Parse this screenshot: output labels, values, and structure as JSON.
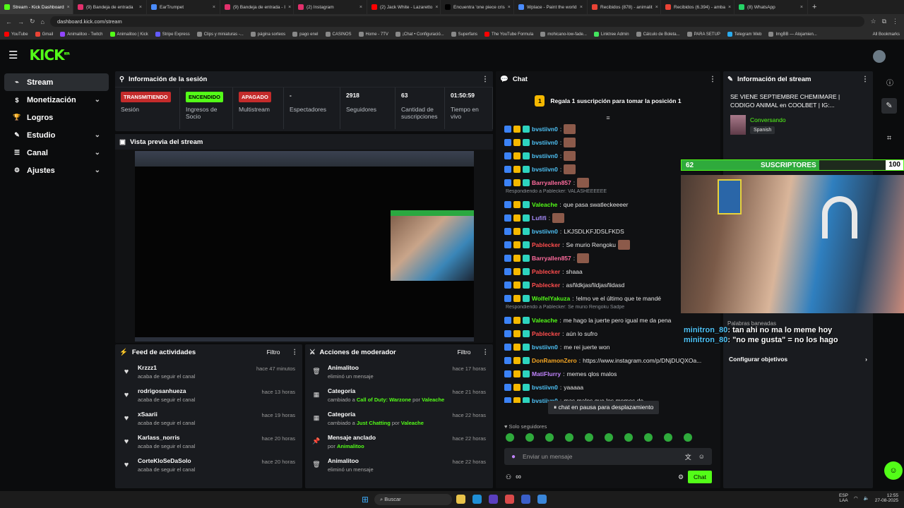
{
  "browser": {
    "tabs": [
      {
        "label": "Stream - Kick Dashboard",
        "color": "#53fc18",
        "active": true
      },
      {
        "label": "(9) Bandeja de entrada",
        "color": "#e1306c"
      },
      {
        "label": "EarTrumpet",
        "color": "#4a8cff"
      },
      {
        "label": "(9) Bandeja de entrada - I",
        "color": "#e1306c"
      },
      {
        "label": "(2) Instagram",
        "color": "#e1306c"
      },
      {
        "label": "(2) Jack White - Lazaretto",
        "color": "#ff0000"
      },
      {
        "label": "Encuentra 'one piece cris",
        "color": "#000000"
      },
      {
        "label": "Wplace - Paint the world",
        "color": "#4a8cff"
      },
      {
        "label": "Recibidos (878) - animalit",
        "color": "#ea4335"
      },
      {
        "label": "Recibidos (6.394) - amba",
        "color": "#ea4335"
      },
      {
        "label": "(8) WhatsApp",
        "color": "#25d366"
      }
    ],
    "url": "dashboard.kick.com/stream",
    "bookmarks": [
      "YouTube",
      "Gmail",
      "Animalitoo - Twitch",
      "Animalitoo | Kick",
      "Stripe Express",
      "Clips y miniaturas -...",
      "página sorteos",
      "pago enel",
      "CASINOS",
      "Home - 7TV",
      "¡Chat • Configuració...",
      "Superfans",
      "The YouTube Formula",
      "mohicano-low-fade...",
      "Linktree Admin",
      "Cálculo de Boleta...",
      "PARA SETUP",
      "Telegram Web",
      "ImgBB — Alojamien..."
    ],
    "all_bookmarks": "All Bookmarks"
  },
  "kick": {
    "logo": "KICK",
    "logo_sup": "BETA"
  },
  "sidebar": {
    "items": [
      {
        "label": "Stream",
        "icon": "stream-icon",
        "active": true
      },
      {
        "label": "Monetización",
        "icon": "dollar-icon",
        "chevron": true
      },
      {
        "label": "Logros",
        "icon": "trophy-icon"
      },
      {
        "label": "Estudio",
        "icon": "studio-icon",
        "chevron": true
      },
      {
        "label": "Canal",
        "icon": "channel-icon",
        "chevron": true
      },
      {
        "label": "Ajustes",
        "icon": "gear-icon",
        "chevron": true
      }
    ]
  },
  "session": {
    "title": "Información de la sesión",
    "stats": [
      {
        "badge": "TRANSMITIENDO",
        "badge_color": "#c42b2b",
        "label": "Sesión"
      },
      {
        "badge": "ENCENDIDO",
        "badge_color": "#53fc18",
        "label": "Ingresos de Socio"
      },
      {
        "badge": "APAGADO",
        "badge_color": "#c42b2b",
        "label": "Multistream"
      },
      {
        "value": "-",
        "label": "Espectadores"
      },
      {
        "value": "2918",
        "label": "Seguidores"
      },
      {
        "value": "63",
        "label": "Cantidad de suscripciones"
      },
      {
        "value": "01:50:59",
        "label": "Tiempo en vivo"
      }
    ]
  },
  "preview": {
    "title": "Vista previa del stream"
  },
  "feed": {
    "title": "Feed de actividades",
    "filter": "Filtro",
    "items": [
      {
        "name": "Krzzz1",
        "sub": "acaba de seguir el canal",
        "time": "hace 47 minutos"
      },
      {
        "name": "rodrigosanhueza",
        "sub": "acaba de seguir el canal",
        "time": "hace 13 horas"
      },
      {
        "name": "xSaarii",
        "sub": "acaba de seguir el canal",
        "time": "hace 19 horas"
      },
      {
        "name": "Karlass_norris",
        "sub": "acaba de seguir el canal",
        "time": "hace 20 horas"
      },
      {
        "name": "CorteKloSeDaSolo",
        "sub": "acaba de seguir el canal",
        "time": "hace 20 horas"
      }
    ]
  },
  "mod": {
    "title": "Acciones de moderador",
    "filter": "Filtro",
    "items": [
      {
        "icon": "trash-icon",
        "title": "Animalitoo",
        "sub": "eliminó un mensaje",
        "time": "hace 17 horas"
      },
      {
        "icon": "calendar-icon",
        "title": "Categoría",
        "sub_pre": "cambiado a ",
        "sub_hl": "Call of Duty: Warzone",
        "sub_mid": " por ",
        "sub_hl2": "Valeache",
        "time": "hace 21 horas"
      },
      {
        "icon": "calendar-icon",
        "title": "Categoría",
        "sub_pre": "cambiado a ",
        "sub_hl": "Just Chatting",
        "sub_mid": " por ",
        "sub_hl2": "Valeache",
        "time": "hace 22 horas"
      },
      {
        "icon": "pin-icon",
        "title": "Mensaje anclado",
        "sub_pre": "por ",
        "sub_hl": "Animalitoo",
        "time": "hace 22 horas"
      },
      {
        "icon": "trash-icon",
        "title": "Animalitoo",
        "sub": "eliminó un mensaje",
        "time": "hace 22 horas"
      }
    ]
  },
  "chat": {
    "title": "Chat",
    "gift_banner": "Regala 1 suscripción para tomar la posición 1",
    "gift_number": "1",
    "lines": [
      {
        "user": "bvstiivn0",
        "color": "#4fc3f7",
        "msg": "",
        "emote": true
      },
      {
        "user": "bvstiivn0",
        "color": "#4fc3f7",
        "msg": "",
        "emote": true
      },
      {
        "user": "bvstiivn0",
        "color": "#4fc3f7",
        "msg": "",
        "emote": true
      },
      {
        "user": "bvstiivn0",
        "color": "#4fc3f7",
        "msg": "",
        "emote": true
      },
      {
        "user": "Barryallen857",
        "color": "#ff6b9d",
        "msg": "",
        "emote": true
      },
      {
        "reply": "Respondiendo a Pablecker: VALASHEEEEEE"
      },
      {
        "user": "Valeache",
        "color": "#53fc18",
        "msg": "que pasa swatleckeeeer"
      },
      {
        "user": "Lufifi",
        "color": "#a78bfa",
        "msg": "",
        "emote": true
      },
      {
        "user": "bvstiivn0",
        "color": "#4fc3f7",
        "msg": "LKJSDLKFJDSLFKDS"
      },
      {
        "user": "Pablecker",
        "color": "#ff4d4d",
        "msg": "Se murio Rengoku",
        "emote": true
      },
      {
        "user": "Barryallen857",
        "color": "#ff6b9d",
        "msg": "",
        "emote": true
      },
      {
        "user": "Pablecker",
        "color": "#ff4d4d",
        "msg": "shaaa"
      },
      {
        "user": "Pablecker",
        "color": "#ff4d4d",
        "msg": "asñldkjasñldjasñldasd"
      },
      {
        "user": "WolfelYakuza",
        "color": "#53fc18",
        "msg": "!elmo ve el último que te mandé"
      },
      {
        "reply": "Respondiendo a Pablecker: Se murio Rengoku Sadpe"
      },
      {
        "user": "Valeache",
        "color": "#53fc18",
        "msg": "me hago la juerte pero igual me da pena"
      },
      {
        "user": "Pablecker",
        "color": "#ff4d4d",
        "msg": "aún lo sufro"
      },
      {
        "user": "bvstiivn0",
        "color": "#4fc3f7",
        "msg": "me rei juerte won"
      },
      {
        "user": "DonRamonZero",
        "color": "#f5a623",
        "msg": "https://www.instagram.com/p/DNjDUQXOa..."
      },
      {
        "user": "MatiFlurry",
        "color": "#c084fc",
        "msg": "memes qlos malos"
      },
      {
        "user": "bvstiivn0",
        "color": "#4fc3f7",
        "msg": "yaaaaa"
      },
      {
        "user": "bvstiivn0",
        "color": "#4fc3f7",
        "msg": "mas malos que los memes de"
      }
    ],
    "paused": "chat en pausa para desplazamiento",
    "followers_only": "Solo seguidores",
    "input_placeholder": "Enviar un mensaje",
    "send_label": "Chat",
    "infinity": "∞"
  },
  "streaminfo": {
    "title": "Información del stream",
    "stream_title": "SE VIENE SEPTIEMBRE CHEMIMARE | CODIGO ANIMAL en COOLBET | IG:...",
    "category": "Conversando",
    "language": "Spanish",
    "banned": "Palabras baneadas",
    "goals": "Configurar objetivos"
  },
  "overlay": {
    "sub_count": "62",
    "sub_label": "SUSCRIPTORES",
    "sub_goal": "100",
    "msg1_user": "minitron_80",
    "msg1_text": "tan ahi no ma lo meme hoy",
    "msg2_user": "minitron_80",
    "msg2_text": "\"no me gusta\" = no los hago"
  },
  "taskbar": {
    "search": "Buscar",
    "lang": "ESP",
    "lang2": "LAA",
    "time": "12:55",
    "date": "27-08-2025"
  }
}
